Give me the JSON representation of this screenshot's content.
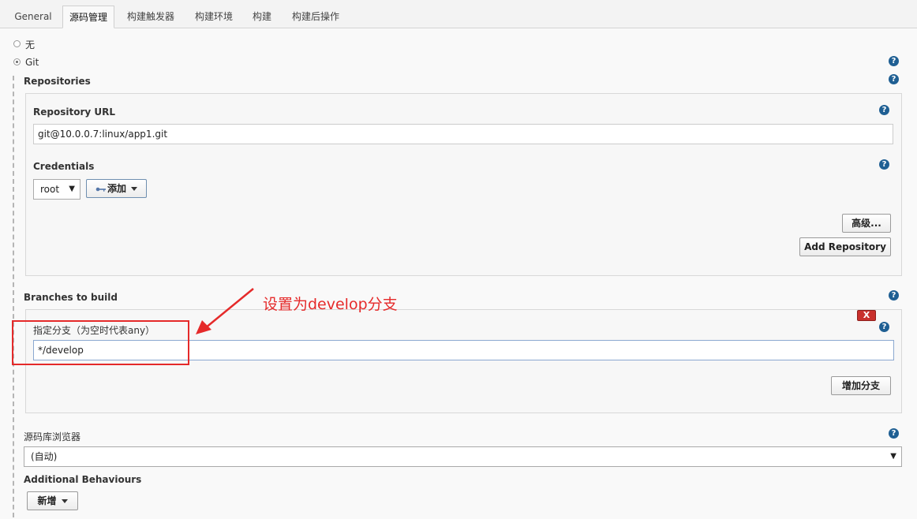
{
  "tabs": [
    {
      "label": "General"
    },
    {
      "label": "源码管理"
    },
    {
      "label": "构建触发器"
    },
    {
      "label": "构建环境"
    },
    {
      "label": "构建"
    },
    {
      "label": "构建后操作"
    }
  ],
  "scm": {
    "option_none": "无",
    "option_git": "Git",
    "selected": "Git"
  },
  "repositories": {
    "label": "Repositories",
    "url_label": "Repository URL",
    "url_value": "git@10.0.0.7:linux/app1.git",
    "credentials_label": "Credentials",
    "credentials_value": "root",
    "add_button": "添加",
    "advanced_button": "高级...",
    "add_repository_button": "Add Repository"
  },
  "branches": {
    "label": "Branches to build",
    "specifier_label": "指定分支（为空时代表any）",
    "specifier_value": "*/develop",
    "delete_button": "X",
    "add_branch_button": "增加分支"
  },
  "browser": {
    "label": "源码库浏览器",
    "value": "(自动)"
  },
  "additional": {
    "label": "Additional Behaviours",
    "add_button": "新增"
  },
  "annotation": {
    "text": "设置为develop分支",
    "color": "#e52a2a"
  },
  "help_glyph": "?",
  "colors": {
    "help": "#1f5f93",
    "delete": "#c9302c",
    "annotation": "#e52a2a"
  }
}
